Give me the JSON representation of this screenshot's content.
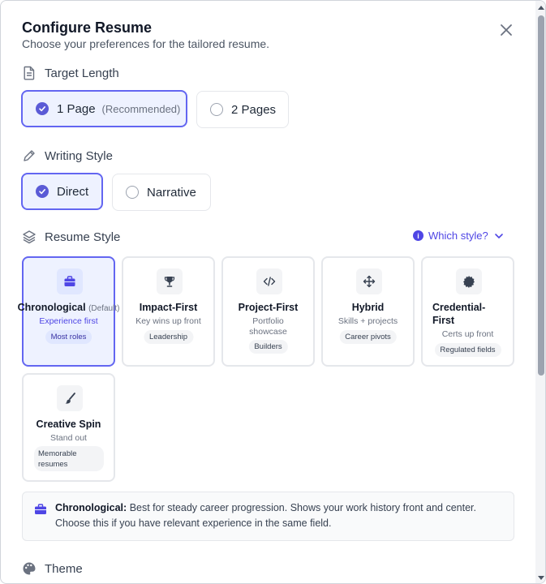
{
  "dialog": {
    "title": "Configure Resume",
    "subtitle": "Choose your preferences for the tailored resume."
  },
  "target_length": {
    "label": "Target Length",
    "options": [
      {
        "label": "1 Page",
        "note": "(Recommended)",
        "selected": true
      },
      {
        "label": "2 Pages",
        "selected": false
      }
    ]
  },
  "writing_style": {
    "label": "Writing Style",
    "options": [
      {
        "label": "Direct",
        "selected": true
      },
      {
        "label": "Narrative",
        "selected": false
      }
    ]
  },
  "resume_style": {
    "label": "Resume Style",
    "help_link": "Which style?",
    "styles": [
      {
        "name": "Chronological",
        "default_note": "(Default)",
        "sub": "Experience first",
        "tag": "Most roles",
        "icon": "briefcase-icon",
        "selected": true
      },
      {
        "name": "Impact-First",
        "sub": "Key wins up front",
        "tag": "Leadership",
        "icon": "trophy-icon",
        "selected": false
      },
      {
        "name": "Project-First",
        "sub1": "Portfolio",
        "sub2": "showcase",
        "tag": "Builders",
        "icon": "code-icon",
        "selected": false
      },
      {
        "name": "Hybrid",
        "sub": "Skills + projects",
        "tag": "Career pivots",
        "icon": "move-icon",
        "selected": false
      },
      {
        "name1": "Credential-",
        "name2": "First",
        "sub": "Certs up front",
        "tag": "Regulated fields",
        "icon": "badge-icon",
        "selected": false
      },
      {
        "name": "Creative Spin",
        "sub": "Stand out",
        "tag1": "Memorable",
        "tag2": "resumes",
        "icon": "brush-icon",
        "selected": false
      }
    ],
    "description": {
      "title": "Chronological:",
      "text": "Best for steady career progression. Shows your work history front and center. Choose this if you have relevant experience in the same field."
    }
  },
  "theme": {
    "label": "Theme"
  },
  "colors": {
    "accent": "#6366f1",
    "selected_bg": "#eef2ff"
  }
}
